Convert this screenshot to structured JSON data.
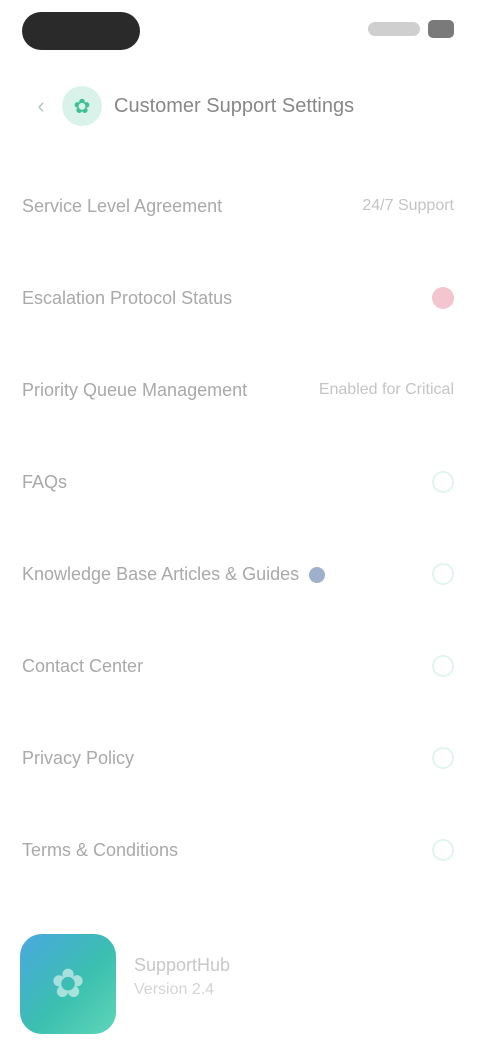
{
  "header": {
    "title": "Customer Support Settings",
    "back_icon": "arrow-left-icon",
    "app_icon": "leaf-icon"
  },
  "rows": [
    {
      "label": "Service Level Agreement",
      "value": "24/7 Support"
    },
    {
      "label": "Escalation Protocol Status",
      "value": ""
    },
    {
      "label": "Priority Queue Management",
      "value": "Enabled for Critical"
    },
    {
      "label": "FAQs",
      "value": ""
    },
    {
      "label": "Knowledge Base Articles & Guides",
      "value": ""
    },
    {
      "label": "Contact Center",
      "value": ""
    },
    {
      "label": "Privacy Policy",
      "value": ""
    },
    {
      "label": "Terms & Conditions",
      "value": ""
    }
  ],
  "app_card": {
    "name": "SupportHub",
    "subtitle": "Version 2.4"
  },
  "colors": {
    "accent": "#3fbf93",
    "alert": "#f3c5cf",
    "info": "#9fb0cc"
  }
}
